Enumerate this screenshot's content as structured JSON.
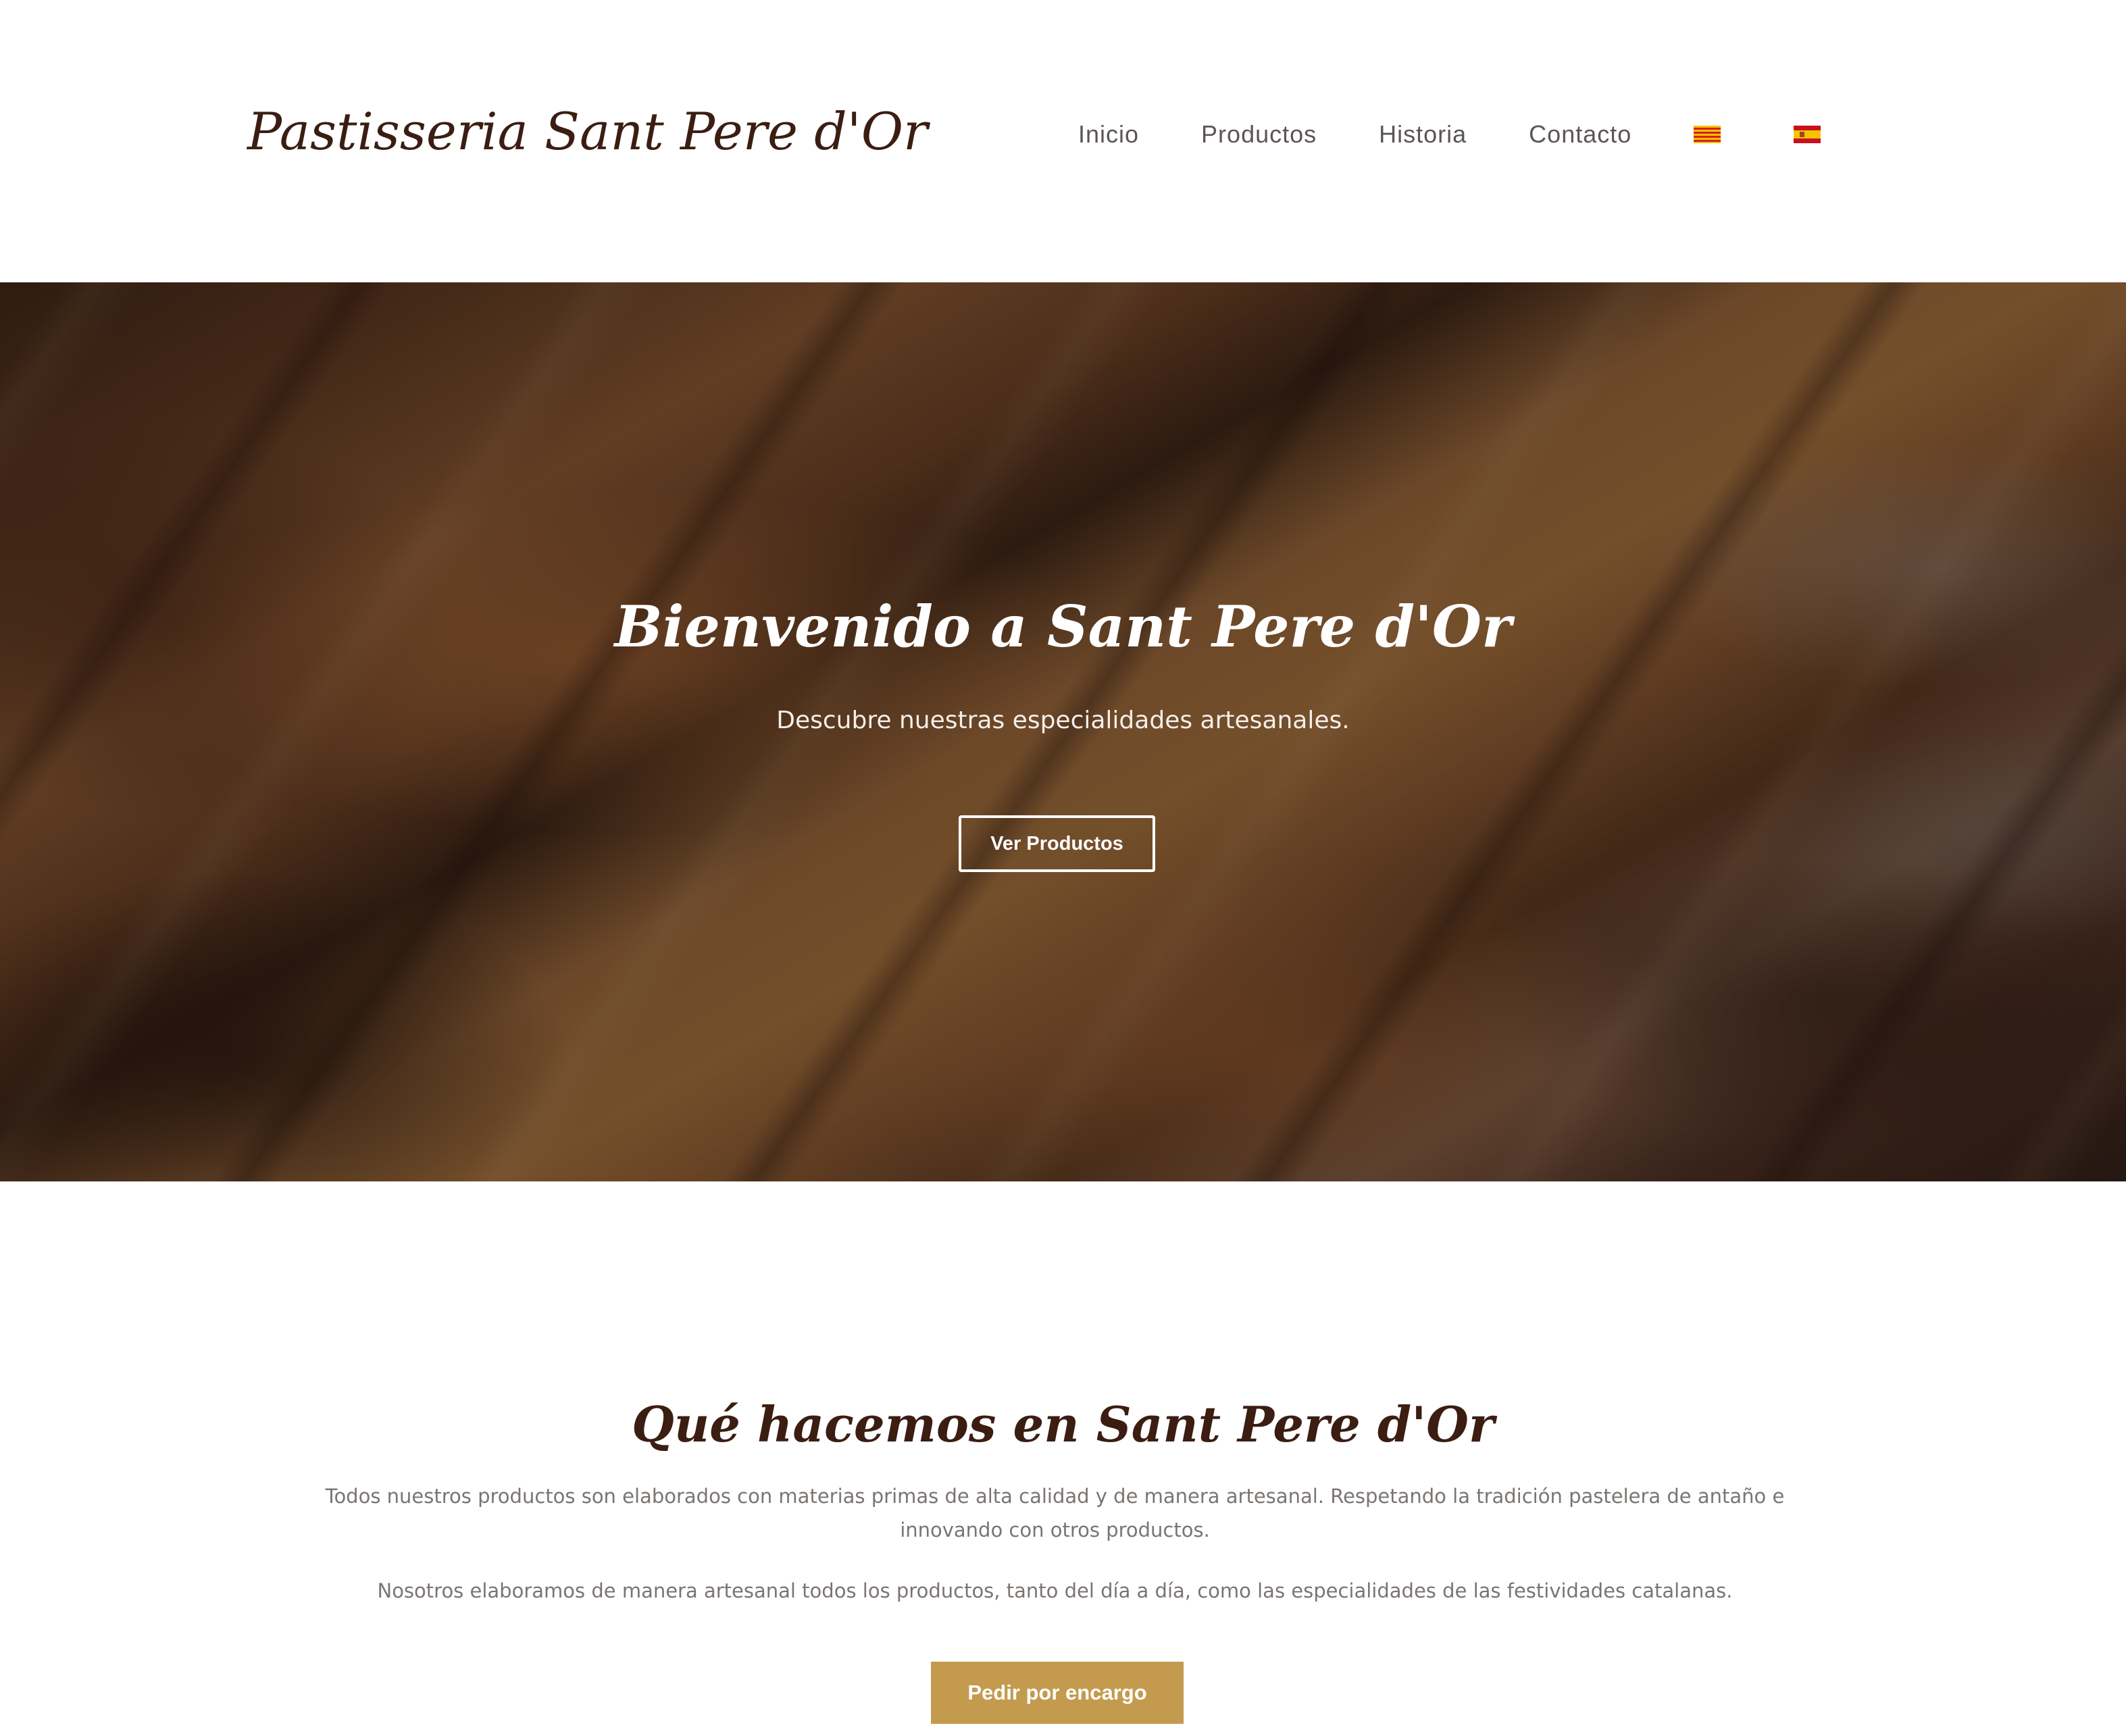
{
  "header": {
    "logo": "Pastisseria Sant Pere d'Or",
    "nav": {
      "inicio": "Inicio",
      "productos": "Productos",
      "historia": "Historia",
      "contacto": "Contacto"
    },
    "flags": [
      "catalan-flag-icon",
      "spanish-flag-icon"
    ]
  },
  "hero": {
    "title": "Bienvenido a Sant Pere d'Or",
    "subtitle": "Descubre nuestras especialidades artesanales.",
    "button_label": "Ver Productos"
  },
  "about": {
    "title": "Qué hacemos en Sant Pere d'Or",
    "paragraph1": "Todos nuestros productos son elaborados con materias primas de alta calidad y de manera artesanal. Respetando la tradición pastelera de antaño e innovando con otros productos.",
    "paragraph2": "Nosotros elaboramos de manera artesanal todos los productos, tanto del día a día, como las especialidades de las festividades catalanas.",
    "button_label": "Pedir por encargo"
  },
  "colors": {
    "brand_brown": "#3b1d12",
    "nav_text": "#5b5553",
    "body_text": "#7a7572",
    "gold_button": "#c49a4e"
  }
}
